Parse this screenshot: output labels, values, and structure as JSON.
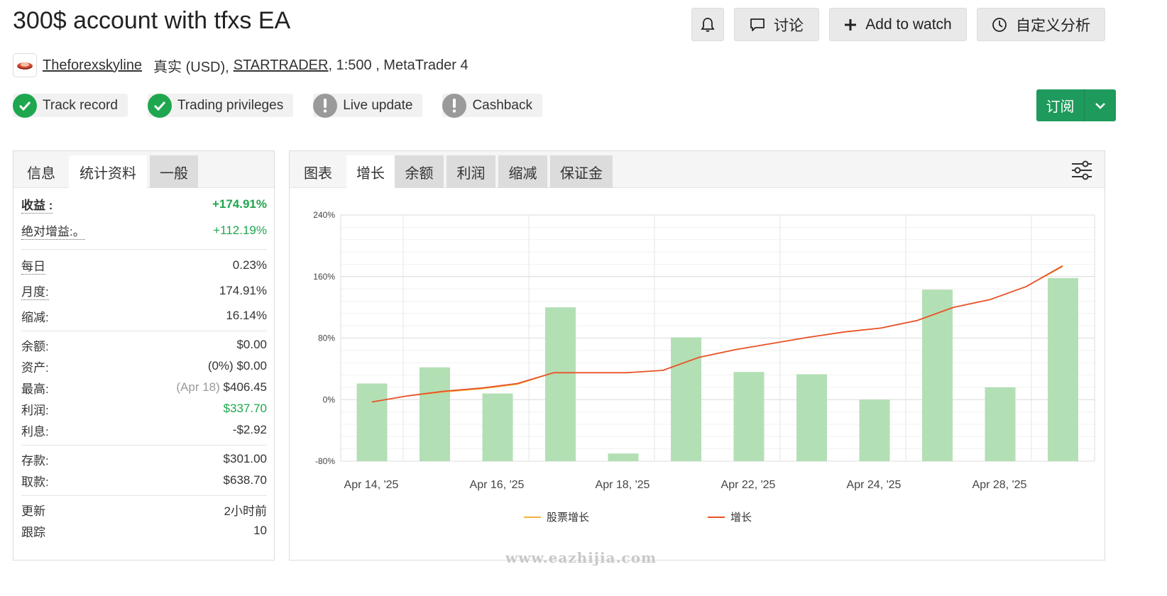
{
  "header": {
    "title": "300$ account with tfxs EA",
    "discuss_label": "讨论",
    "watch_label": "Add to watch",
    "analysis_label": "自定义分析"
  },
  "account": {
    "owner": "Theforexskyline",
    "type": "真实 (USD),",
    "broker": "STARTRADER",
    "details": ", 1:500 , MetaTrader 4"
  },
  "badges": [
    {
      "label": "Track record",
      "status": "ok"
    },
    {
      "label": "Trading privileges",
      "status": "ok"
    },
    {
      "label": "Live update",
      "status": "warn"
    },
    {
      "label": "Cashback",
      "status": "warn"
    }
  ],
  "subscribe_label": "订阅",
  "left_tabs": [
    "信息",
    "统计资料",
    "一般"
  ],
  "stats": {
    "gain": {
      "label": "收益 :",
      "value": "+174.91%"
    },
    "abs_gain": {
      "label": "绝对增益:。",
      "value": "+112.19%"
    },
    "daily": {
      "label": "每日",
      "value": "0.23%"
    },
    "monthly": {
      "label": "月度:",
      "value": "174.91%"
    },
    "drawdown": {
      "label": "缩减:",
      "value": "16.14%"
    },
    "balance": {
      "label": "余额:",
      "value": "$0.00"
    },
    "equity": {
      "label": "资产:",
      "pct": "(0%)",
      "value": "$0.00"
    },
    "highest": {
      "label": "最高:",
      "date": "(Apr 18)",
      "value": "$406.45"
    },
    "profit": {
      "label": "利润:",
      "value": "$337.70"
    },
    "interest": {
      "label": "利息:",
      "value": "-$2.92"
    },
    "deposits": {
      "label": "存款:",
      "value": "$301.00"
    },
    "withdrawals": {
      "label": "取款:",
      "value": "$638.70"
    },
    "updated": {
      "label": "更新",
      "value": "2小时前"
    },
    "tracking": {
      "label": "跟踪",
      "value": "10"
    }
  },
  "chart_tabs": [
    "图表",
    "增长",
    "余额",
    "利润",
    "缩减",
    "保证金"
  ],
  "colors": {
    "bar": "#b3dfb4",
    "growth_line": "#e8532a",
    "equity_growth_line": "#f3b43a",
    "green_text": "#1fa74f",
    "subscribe_bg": "#1e9a5c"
  },
  "chart_data": {
    "type": "bar+line",
    "ylim": [
      -80,
      240
    ],
    "y_ticks": [
      "240%",
      "160%",
      "80%",
      "0%",
      "-80%"
    ],
    "y_tick_values": [
      240,
      160,
      80,
      0,
      -80
    ],
    "x_tick_labels": [
      "Apr 14, '25",
      "Apr 16, '25",
      "Apr 18, '25",
      "Apr 22, '25",
      "Apr 24, '25",
      "Apr 28, '25"
    ],
    "bars": [
      21,
      42,
      8,
      120,
      -70,
      81,
      36,
      33,
      0,
      143,
      16,
      158
    ],
    "series": [
      {
        "name": "股票增长",
        "color": "#f3b43a",
        "values": [
          -3,
          5,
          10,
          14,
          20,
          35,
          35,
          35,
          38,
          55,
          65,
          73,
          81,
          88,
          93,
          103,
          120,
          130,
          147,
          173
        ]
      },
      {
        "name": "增长",
        "color": "#e8532a",
        "values": [
          -3,
          5,
          11,
          15,
          21,
          35,
          35,
          35,
          38,
          55,
          65,
          73,
          81,
          88,
          93,
          103,
          120,
          130,
          147,
          174
        ]
      }
    ]
  }
}
